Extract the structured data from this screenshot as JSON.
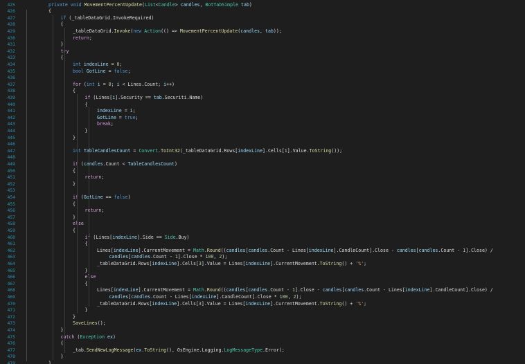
{
  "editor": {
    "colors": {
      "background": "#1e1e1e",
      "line_number": "#2b91af",
      "keyword": "#569cd6",
      "type": "#4ec9b0",
      "method": "#dcdcaa",
      "variable": "#9cdcfe",
      "string": "#d69d85",
      "number": "#b5cea8",
      "text": "#dcdcdc",
      "control": "#d8a0df"
    },
    "lines": [
      {
        "n": "425",
        "indent": 1,
        "t": [
          [
            "private ",
            "kw"
          ],
          [
            "void ",
            "kw"
          ],
          [
            "MovementPercentUpdate",
            "mt"
          ],
          [
            "(",
            "tx"
          ],
          [
            "List",
            "ty"
          ],
          [
            "<",
            "tx"
          ],
          [
            "Candle",
            "ty"
          ],
          [
            "> ",
            "tx"
          ],
          [
            "candles",
            "vr"
          ],
          [
            ", ",
            "tx"
          ],
          [
            "BotTabSimple ",
            "ty"
          ],
          [
            "tab",
            "vr"
          ],
          [
            ")",
            "tx"
          ]
        ]
      },
      {
        "n": "426",
        "indent": 1,
        "t": [
          [
            "{",
            "tx"
          ]
        ]
      },
      {
        "n": "427",
        "indent": 2,
        "t": [
          [
            "if ",
            "kw"
          ],
          [
            "(_tableDataGrid.InvokeRequired)",
            "tx"
          ]
        ]
      },
      {
        "n": "428",
        "indent": 2,
        "t": [
          [
            "{",
            "tx"
          ]
        ]
      },
      {
        "n": "429",
        "indent": 3,
        "t": [
          [
            "_tableDataGrid.",
            "tx"
          ],
          [
            "Invoke",
            "mt"
          ],
          [
            "(",
            "tx"
          ],
          [
            "new ",
            "kw"
          ],
          [
            "Action",
            "ty"
          ],
          [
            "(() => ",
            "tx"
          ],
          [
            "MovementPercentUpdate",
            "mt"
          ],
          [
            "(",
            "tx"
          ],
          [
            "candles",
            "vr"
          ],
          [
            ", ",
            "tx"
          ],
          [
            "tab",
            "vr"
          ],
          [
            "));",
            "tx"
          ]
        ]
      },
      {
        "n": "430",
        "indent": 3,
        "t": [
          [
            "return",
            "ct"
          ],
          [
            ";",
            "tx"
          ]
        ]
      },
      {
        "n": "431",
        "indent": 2,
        "t": [
          [
            "}",
            "tx"
          ]
        ]
      },
      {
        "n": "432",
        "indent": 2,
        "t": [
          [
            "try",
            "ct"
          ]
        ]
      },
      {
        "n": "433",
        "indent": 2,
        "t": [
          [
            "{",
            "tx"
          ]
        ]
      },
      {
        "n": "434",
        "indent": 3,
        "t": [
          [
            "int ",
            "kw"
          ],
          [
            "indexLine",
            "vr"
          ],
          [
            " = ",
            "tx"
          ],
          [
            "0",
            "nm"
          ],
          [
            ";",
            "tx"
          ]
        ]
      },
      {
        "n": "435",
        "indent": 3,
        "t": [
          [
            "bool ",
            "kw"
          ],
          [
            "GotLine",
            "vr"
          ],
          [
            " = ",
            "tx"
          ],
          [
            "false",
            "kw"
          ],
          [
            ";",
            "tx"
          ]
        ]
      },
      {
        "n": "436",
        "indent": 3,
        "t": []
      },
      {
        "n": "437",
        "indent": 3,
        "t": [
          [
            "for ",
            "ct"
          ],
          [
            "(",
            "tx"
          ],
          [
            "int ",
            "kw"
          ],
          [
            "i",
            "vr"
          ],
          [
            " = ",
            "tx"
          ],
          [
            "0",
            "nm"
          ],
          [
            "; ",
            "tx"
          ],
          [
            "i",
            "vr"
          ],
          [
            " < Lines.Count; ",
            "tx"
          ],
          [
            "i",
            "vr"
          ],
          [
            "++)",
            "tx"
          ]
        ]
      },
      {
        "n": "438",
        "indent": 3,
        "t": [
          [
            "{",
            "tx"
          ]
        ]
      },
      {
        "n": "439",
        "indent": 4,
        "t": [
          [
            "if ",
            "ct"
          ],
          [
            "(Lines[",
            "tx"
          ],
          [
            "i",
            "vr"
          ],
          [
            "].Security == ",
            "tx"
          ],
          [
            "tab",
            "vr"
          ],
          [
            ".Securiti.Name)",
            "tx"
          ]
        ]
      },
      {
        "n": "440",
        "indent": 4,
        "t": [
          [
            "{",
            "tx"
          ]
        ]
      },
      {
        "n": "441",
        "indent": 5,
        "t": [
          [
            "indexLine",
            "vr"
          ],
          [
            " = ",
            "tx"
          ],
          [
            "i",
            "vr"
          ],
          [
            ";",
            "tx"
          ]
        ]
      },
      {
        "n": "442",
        "indent": 5,
        "t": [
          [
            "GotLine",
            "vr"
          ],
          [
            " = ",
            "tx"
          ],
          [
            "true",
            "kw"
          ],
          [
            ";",
            "tx"
          ]
        ]
      },
      {
        "n": "443",
        "indent": 5,
        "t": [
          [
            "break",
            "ct"
          ],
          [
            ";",
            "tx"
          ]
        ]
      },
      {
        "n": "444",
        "indent": 4,
        "t": [
          [
            "}",
            "tx"
          ]
        ]
      },
      {
        "n": "445",
        "indent": 3,
        "t": [
          [
            "}",
            "tx"
          ]
        ]
      },
      {
        "n": "446",
        "indent": 3,
        "t": []
      },
      {
        "n": "447",
        "indent": 3,
        "t": [
          [
            "int ",
            "kw"
          ],
          [
            "TableCandlesCount",
            "vr"
          ],
          [
            " = ",
            "tx"
          ],
          [
            "Convert",
            "ty"
          ],
          [
            ".",
            "tx"
          ],
          [
            "ToInt32",
            "mt"
          ],
          [
            "(_tableDataGrid.Rows[",
            "tx"
          ],
          [
            "indexLine",
            "vr"
          ],
          [
            "].Cells[",
            "tx"
          ],
          [
            "1",
            "nm"
          ],
          [
            "].Value.",
            "tx"
          ],
          [
            "ToString",
            "mt"
          ],
          [
            "());",
            "tx"
          ]
        ]
      },
      {
        "n": "448",
        "indent": 3,
        "t": []
      },
      {
        "n": "449",
        "indent": 3,
        "t": [
          [
            "if ",
            "ct"
          ],
          [
            "(",
            "tx"
          ],
          [
            "candles",
            "vr"
          ],
          [
            ".Count < ",
            "tx"
          ],
          [
            "TableCandlesCount",
            "vr"
          ],
          [
            ")",
            "tx"
          ]
        ]
      },
      {
        "n": "450",
        "indent": 3,
        "t": [
          [
            "{",
            "tx"
          ]
        ]
      },
      {
        "n": "451",
        "indent": 4,
        "t": [
          [
            "return",
            "ct"
          ],
          [
            ";",
            "tx"
          ]
        ]
      },
      {
        "n": "452",
        "indent": 3,
        "t": [
          [
            "}",
            "tx"
          ]
        ]
      },
      {
        "n": "453",
        "indent": 3,
        "t": []
      },
      {
        "n": "454",
        "indent": 3,
        "t": [
          [
            "if ",
            "ct"
          ],
          [
            "(",
            "tx"
          ],
          [
            "GotLine",
            "vr"
          ],
          [
            " == ",
            "tx"
          ],
          [
            "false",
            "kw"
          ],
          [
            ")",
            "tx"
          ]
        ]
      },
      {
        "n": "455",
        "indent": 3,
        "t": [
          [
            "{",
            "tx"
          ]
        ]
      },
      {
        "n": "456",
        "indent": 4,
        "t": [
          [
            "return",
            "ct"
          ],
          [
            ";",
            "tx"
          ]
        ]
      },
      {
        "n": "457",
        "indent": 3,
        "t": [
          [
            "}",
            "tx"
          ]
        ]
      },
      {
        "n": "458",
        "indent": 3,
        "t": [
          [
            "else",
            "ct"
          ]
        ]
      },
      {
        "n": "459",
        "indent": 3,
        "t": [
          [
            "{",
            "tx"
          ]
        ]
      },
      {
        "n": "460",
        "indent": 4,
        "t": [
          [
            "if ",
            "ct"
          ],
          [
            "(Lines[",
            "tx"
          ],
          [
            "indexLine",
            "vr"
          ],
          [
            "].Side == ",
            "tx"
          ],
          [
            "Side",
            "ty"
          ],
          [
            ".Buy)",
            "tx"
          ]
        ]
      },
      {
        "n": "461",
        "indent": 4,
        "t": [
          [
            "{",
            "tx"
          ]
        ]
      },
      {
        "n": "462",
        "indent": 5,
        "t": [
          [
            "Lines[",
            "tx"
          ],
          [
            "indexLine",
            "vr"
          ],
          [
            "].CurrentMovement = ",
            "tx"
          ],
          [
            "Math",
            "ty"
          ],
          [
            ".",
            "tx"
          ],
          [
            "Round",
            "mt"
          ],
          [
            "((",
            "tx"
          ],
          [
            "candles",
            "vr"
          ],
          [
            "[",
            "tx"
          ],
          [
            "candles",
            "vr"
          ],
          [
            ".Count - Lines[",
            "tx"
          ],
          [
            "indexLine",
            "vr"
          ],
          [
            "].CandleCount].Close - ",
            "tx"
          ],
          [
            "candles",
            "vr"
          ],
          [
            "[",
            "tx"
          ],
          [
            "candles",
            "vr"
          ],
          [
            ".Count - ",
            "tx"
          ],
          [
            "1",
            "nm"
          ],
          [
            "].Close) /",
            "tx"
          ]
        ]
      },
      {
        "n": "463",
        "indent": 6,
        "t": [
          [
            "candles",
            "vr"
          ],
          [
            "[",
            "tx"
          ],
          [
            "candles",
            "vr"
          ],
          [
            ".Count - ",
            "tx"
          ],
          [
            "1",
            "nm"
          ],
          [
            "].Close * ",
            "tx"
          ],
          [
            "100",
            "nm"
          ],
          [
            ", ",
            "tx"
          ],
          [
            "2",
            "nm"
          ],
          [
            ");",
            "tx"
          ]
        ]
      },
      {
        "n": "464",
        "indent": 5,
        "t": [
          [
            "_tableDataGrid.Rows[",
            "tx"
          ],
          [
            "indexLine",
            "vr"
          ],
          [
            "].Cells[",
            "tx"
          ],
          [
            "3",
            "nm"
          ],
          [
            "].Value = Lines[",
            "tx"
          ],
          [
            "indexLine",
            "vr"
          ],
          [
            "].CurrentMovement.",
            "tx"
          ],
          [
            "ToString",
            "mt"
          ],
          [
            "() + ",
            "tx"
          ],
          [
            "'%'",
            "st"
          ],
          [
            ";",
            "tx"
          ]
        ]
      },
      {
        "n": "465",
        "indent": 4,
        "t": [
          [
            "}",
            "tx"
          ]
        ]
      },
      {
        "n": "466",
        "indent": 4,
        "t": [
          [
            "else",
            "ct"
          ]
        ]
      },
      {
        "n": "467",
        "indent": 4,
        "t": [
          [
            "{",
            "tx"
          ]
        ]
      },
      {
        "n": "468",
        "indent": 5,
        "t": [
          [
            "Lines[",
            "tx"
          ],
          [
            "indexLine",
            "vr"
          ],
          [
            "].CurrentMovement = ",
            "tx"
          ],
          [
            "Math",
            "ty"
          ],
          [
            ".",
            "tx"
          ],
          [
            "Round",
            "mt"
          ],
          [
            "((",
            "tx"
          ],
          [
            "candles",
            "vr"
          ],
          [
            "[",
            "tx"
          ],
          [
            "candles",
            "vr"
          ],
          [
            ".Count - ",
            "tx"
          ],
          [
            "1",
            "nm"
          ],
          [
            "].Close - ",
            "tx"
          ],
          [
            "candles",
            "vr"
          ],
          [
            "[",
            "tx"
          ],
          [
            "candles",
            "vr"
          ],
          [
            ".Count - Lines[",
            "tx"
          ],
          [
            "indexLine",
            "vr"
          ],
          [
            "].CandleCount].Close) /",
            "tx"
          ]
        ]
      },
      {
        "n": "469",
        "indent": 6,
        "t": [
          [
            "candles",
            "vr"
          ],
          [
            "[",
            "tx"
          ],
          [
            "candles",
            "vr"
          ],
          [
            ".Count - Lines[",
            "tx"
          ],
          [
            "indexLine",
            "vr"
          ],
          [
            "].CandleCount].Close * ",
            "tx"
          ],
          [
            "100",
            "nm"
          ],
          [
            ", ",
            "tx"
          ],
          [
            "2",
            "nm"
          ],
          [
            ");",
            "tx"
          ]
        ]
      },
      {
        "n": "470",
        "indent": 5,
        "t": [
          [
            "_tableDataGrid.Rows[",
            "tx"
          ],
          [
            "indexLine",
            "vr"
          ],
          [
            "].Cells[",
            "tx"
          ],
          [
            "3",
            "nm"
          ],
          [
            "].Value = Lines[",
            "tx"
          ],
          [
            "indexLine",
            "vr"
          ],
          [
            "].CurrentMovement.",
            "tx"
          ],
          [
            "ToString",
            "mt"
          ],
          [
            "() + ",
            "tx"
          ],
          [
            "'%'",
            "st"
          ],
          [
            ";",
            "tx"
          ]
        ]
      },
      {
        "n": "471",
        "indent": 4,
        "t": [
          [
            "}",
            "tx"
          ]
        ]
      },
      {
        "n": "472",
        "indent": 3,
        "t": [
          [
            "}",
            "tx"
          ]
        ]
      },
      {
        "n": "473",
        "indent": 3,
        "t": [
          [
            "SaveLines",
            "mt"
          ],
          [
            "();",
            "tx"
          ]
        ]
      },
      {
        "n": "474",
        "indent": 2,
        "t": [
          [
            "}",
            "tx"
          ]
        ]
      },
      {
        "n": "475",
        "indent": 2,
        "t": [
          [
            "catch ",
            "ct"
          ],
          [
            "(",
            "tx"
          ],
          [
            "Exception ",
            "ty"
          ],
          [
            "ex",
            "vr"
          ],
          [
            ")",
            "tx"
          ]
        ]
      },
      {
        "n": "476",
        "indent": 2,
        "t": [
          [
            "{",
            "tx"
          ]
        ]
      },
      {
        "n": "477",
        "indent": 3,
        "t": [
          [
            "_tab.",
            "tx"
          ],
          [
            "SendNewLogMessage",
            "mt"
          ],
          [
            "(",
            "tx"
          ],
          [
            "ex",
            "vr"
          ],
          [
            ".",
            "tx"
          ],
          [
            "ToString",
            "mt"
          ],
          [
            "(), OsEngine.Logging.",
            "tx"
          ],
          [
            "LogMessageType",
            "ty"
          ],
          [
            ".Error);",
            "tx"
          ]
        ]
      },
      {
        "n": "478",
        "indent": 2,
        "t": [
          [
            "}",
            "tx"
          ]
        ]
      },
      {
        "n": "479",
        "indent": 1,
        "t": [
          [
            "}",
            "tx"
          ]
        ]
      }
    ]
  }
}
